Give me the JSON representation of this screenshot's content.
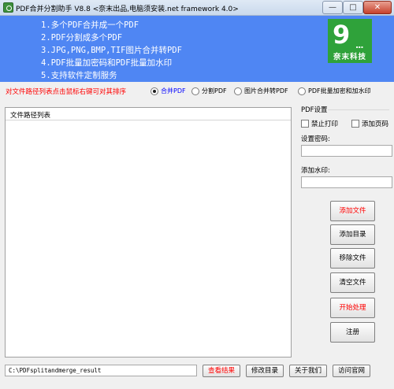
{
  "window": {
    "title": "PDF合并分割助手 V8.8 <奈末出品,电脑须安装.net framework 4.0>",
    "minimize_glyph": "—",
    "maximize_glyph": "□",
    "close_glyph": "✕"
  },
  "banner": {
    "features": [
      "1.多个PDF合并成一个PDF",
      "2.PDF分割成多个PDF",
      "3.JPG,PNG,BMP,TIF图片合并转PDF",
      "4.PDF批量加密码和PDF批量加水印",
      "5.支持软件定制服务"
    ],
    "logo_mark": "9",
    "logo_dots": "...",
    "logo_text": "奈末科技",
    "background_color": "#4f86f3",
    "logo_color": "#2fa23a"
  },
  "hint": "对文件路径列表点击鼠标右键可对其排序",
  "modes": [
    {
      "label": "合并PDF",
      "selected": true
    },
    {
      "label": "分割PDF",
      "selected": false
    },
    {
      "label": "图片合并转PDF",
      "selected": false
    },
    {
      "label": "PDF批量加密和加水印",
      "selected": false
    }
  ],
  "file_list": {
    "header": "文件路径列表",
    "rows": []
  },
  "pdf_settings": {
    "title": "PDF设置",
    "no_print_label": "禁止打印",
    "no_print_checked": false,
    "add_page_number_label": "添加页码",
    "add_page_number_checked": false,
    "password_label": "设置密码:",
    "password_value": "",
    "watermark_label": "添加水印:",
    "watermark_value": ""
  },
  "buttons": {
    "add_file": "添加文件",
    "add_folder": "添加目录",
    "remove_file": "移除文件",
    "clear_files": "清空文件",
    "start": "开始处理",
    "register": "注册"
  },
  "bottom": {
    "output_path": "C:\\PDFsplitandmerge_result",
    "view_result": "查看结果",
    "change_dir": "修改目录",
    "about": "关于我们",
    "visit_site": "访问官网"
  },
  "colors": {
    "accent_red": "#ff0000",
    "selected_blue": "#0000ff"
  }
}
